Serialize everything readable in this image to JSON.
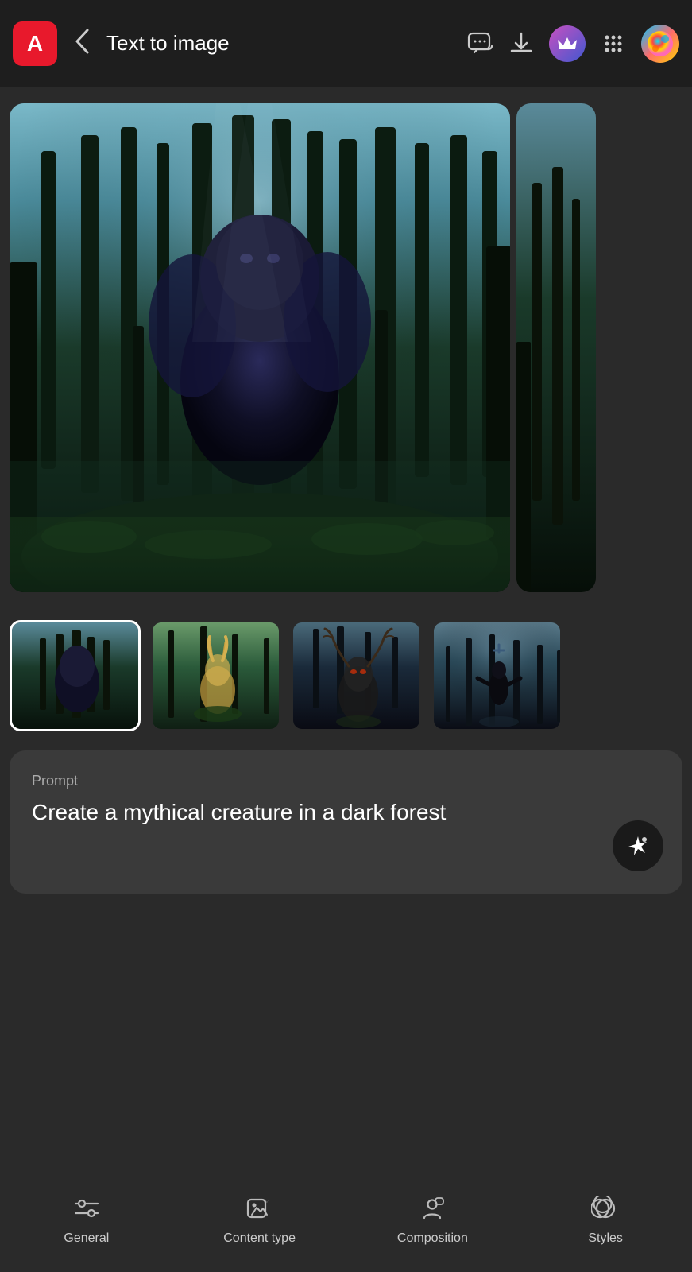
{
  "header": {
    "title": "Text to image",
    "back_label": "‹",
    "logo_text": "A"
  },
  "prompt": {
    "label": "Prompt",
    "text": "Create a mythical creature in a dark forest"
  },
  "thumbnails": [
    {
      "id": 1,
      "label": "thumbnail 1",
      "active": true
    },
    {
      "id": 2,
      "label": "thumbnail 2",
      "active": false
    },
    {
      "id": 3,
      "label": "thumbnail 3",
      "active": false
    },
    {
      "id": 4,
      "label": "thumbnail 4",
      "active": false
    }
  ],
  "toolbar": {
    "items": [
      {
        "id": "general",
        "label": "General",
        "icon": "sliders"
      },
      {
        "id": "content-type",
        "label": "Content type",
        "icon": "content-type"
      },
      {
        "id": "composition",
        "label": "Composition",
        "icon": "person"
      },
      {
        "id": "styles",
        "label": "Styles",
        "icon": "styles"
      }
    ]
  },
  "icons": {
    "chat": "💬",
    "download": "⬇",
    "crown": "♛",
    "grid": "⋮⋮⋮",
    "generate": "✦",
    "back": "‹"
  }
}
